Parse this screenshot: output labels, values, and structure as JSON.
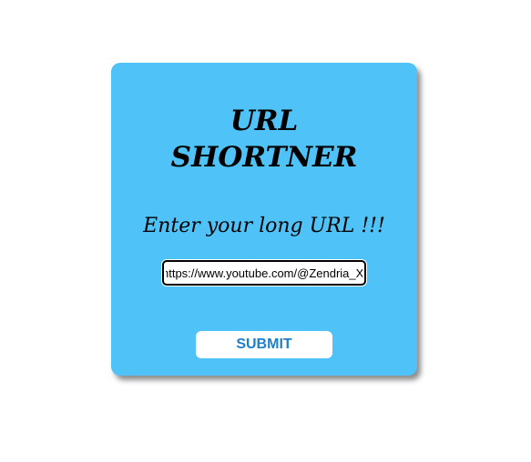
{
  "form": {
    "title_line1": "URL",
    "title_line2": "SHORTNER",
    "prompt": "Enter your long URL !!!",
    "url_value": "https://www.youtube.com/@Zendria_X",
    "submit_label": "SUBMIT"
  },
  "colors": {
    "card_background": "#4fc3f7",
    "submit_text": "#1e7fcb",
    "page_background": "#ffffff"
  }
}
